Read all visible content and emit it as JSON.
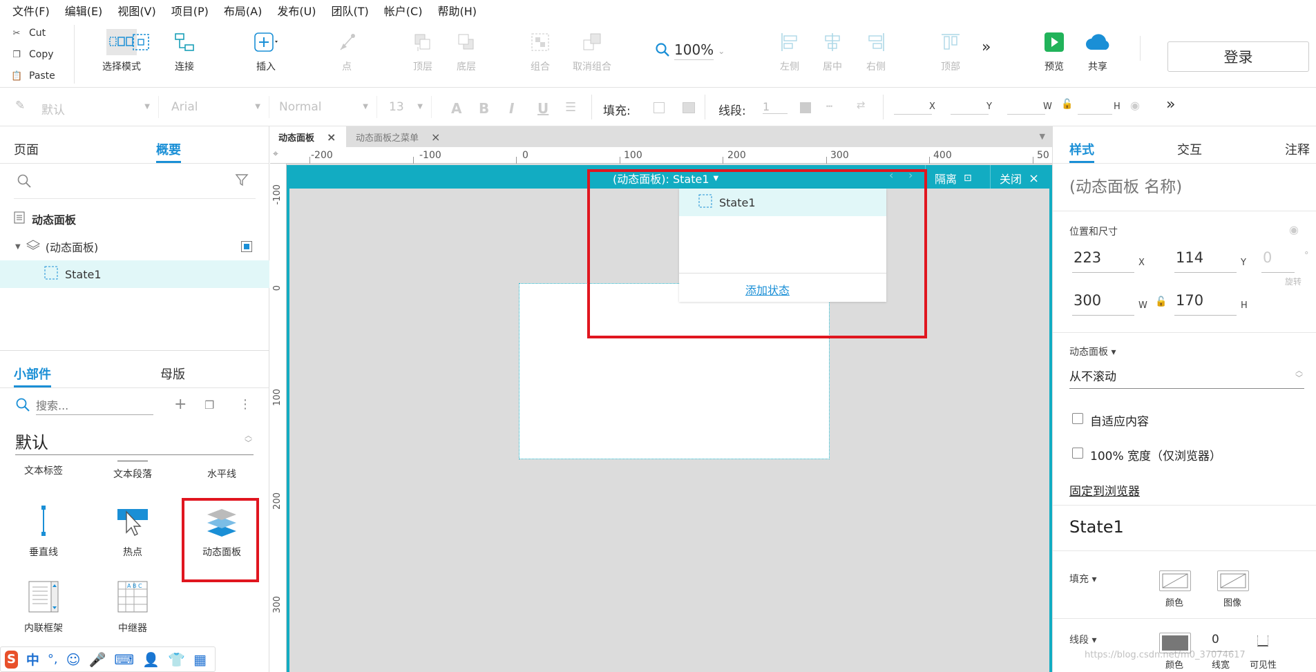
{
  "menu": [
    "文件(F)",
    "编辑(E)",
    "视图(V)",
    "项目(P)",
    "布局(A)",
    "发布(U)",
    "团队(T)",
    "帐户(C)",
    "帮助(H)"
  ],
  "clipboard": {
    "cut": "Cut",
    "copy": "Copy",
    "paste": "Paste"
  },
  "tools": {
    "select": "选择模式",
    "connect": "连接",
    "insert": "插入",
    "point": "点",
    "front": "顶层",
    "back": "底层",
    "group": "组合",
    "ungroup": "取消组合",
    "left": "左侧",
    "center": "居中",
    "right": "右侧",
    "top": "顶部",
    "preview": "预览",
    "share": "共享"
  },
  "zoom": "100%",
  "login": "登录",
  "stylebar": {
    "style": "默认",
    "font": "Arial",
    "weight": "Normal",
    "size": "13",
    "fill_label": "填充:",
    "line_label": "线段:",
    "line_value": "1",
    "x": "X",
    "y": "Y",
    "w": "W",
    "h": "H"
  },
  "left": {
    "tab_pages": "页面",
    "tab_outline": "概要",
    "tree": {
      "root": "动态面板",
      "panel": "(动态面板)",
      "state": "State1"
    },
    "tab_widgets": "小部件",
    "tab_masters": "母版",
    "search_placeholder": "搜索...",
    "library": "默认",
    "widgets": [
      "文本标签",
      "文本段落",
      "水平线",
      "垂直线",
      "热点",
      "动态面板",
      "内联框架",
      "中继器"
    ]
  },
  "doc_tabs": [
    "动态面板",
    "动态面板之菜单"
  ],
  "ruler": {
    "h": [
      "-200",
      "-100",
      "0",
      "100",
      "200",
      "300",
      "400",
      "50"
    ],
    "v": [
      "-100",
      "0",
      "100",
      "200",
      "300"
    ]
  },
  "editor": {
    "title": "(动态面板): State1",
    "isolate": "隔离",
    "close": "关闭",
    "state_item": "State1",
    "add_state": "添加状态"
  },
  "right": {
    "tab_style": "样式",
    "tab_interact": "交互",
    "tab_notes": "注释",
    "name_placeholder": "(动态面板 名称)",
    "pos_size": "位置和尺寸",
    "x": "223",
    "x_label": "X",
    "y": "114",
    "y_label": "Y",
    "rot": "0",
    "rot_unit": "°",
    "rot_label": "旋转",
    "w": "300",
    "w_label": "W",
    "h": "170",
    "h_label": "H",
    "section_panel": "动态面板 ▾",
    "scroll": "从不滚动",
    "fit_content": "自适应内容",
    "full_width": "100% 宽度（仅浏览器）",
    "pin": "固定到浏览器",
    "state_title": "State1",
    "fill_label": "填充 ▾",
    "color": "颜色",
    "image": "图像",
    "line_label": "线段 ▾",
    "line_color": "颜色",
    "line_width": "0",
    "line_width_label": "线宽",
    "visibility": "可见性"
  },
  "ime": {
    "cn": "中",
    "punct": "°,"
  },
  "watermark": "https://blog.csdn.net/m0_37074617",
  "colors": {
    "accent": "#1a8fd6",
    "teal": "#12acc2",
    "red": "#e0161f"
  }
}
